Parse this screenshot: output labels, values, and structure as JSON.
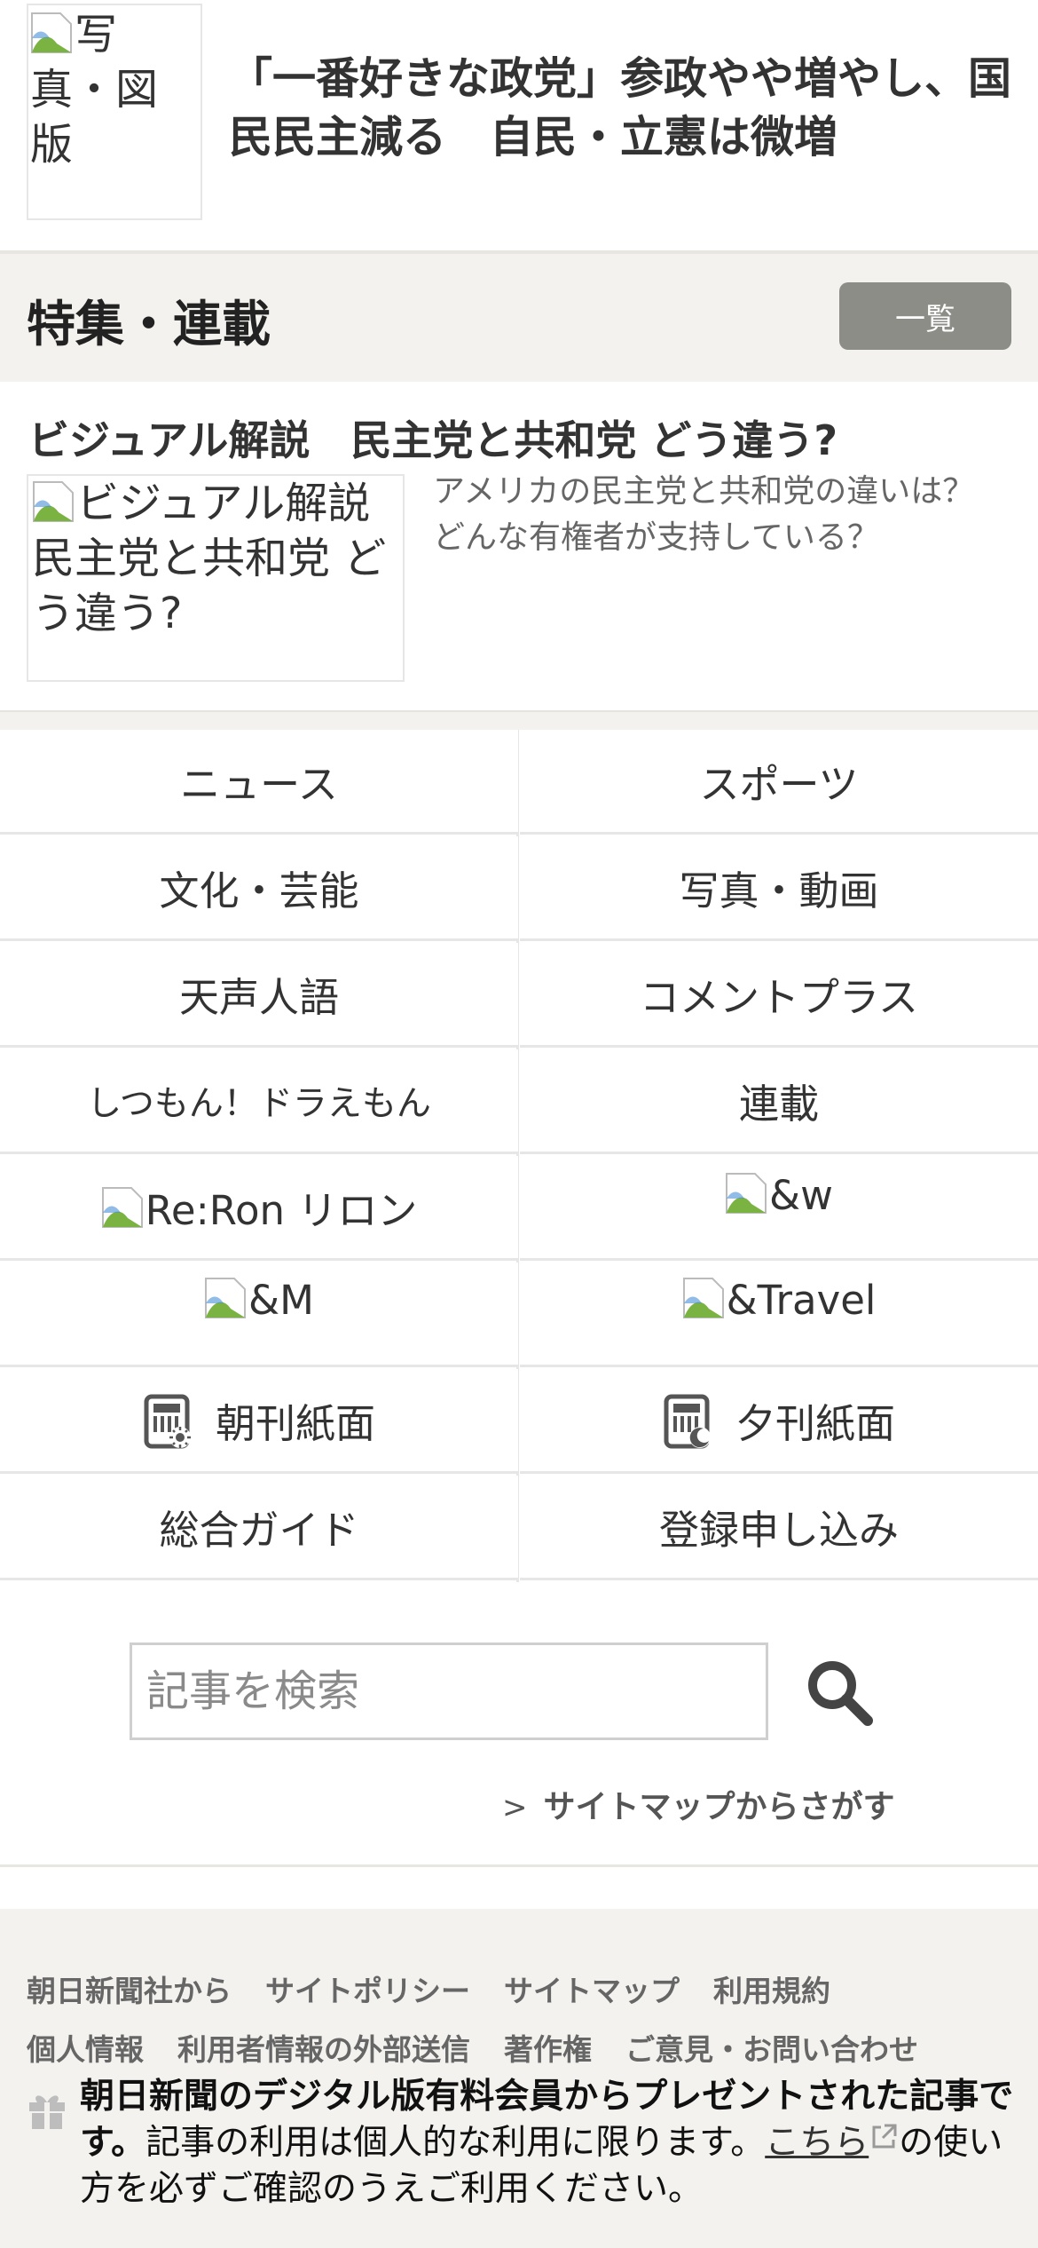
{
  "top_article": {
    "thumb_alt": "写真・図版",
    "title": "「一番好きな政党」参政やや増やし、国民民主減る　自民・立憲は微増"
  },
  "features": {
    "heading": "特集・連載",
    "list_button": "一覧",
    "article": {
      "title": "ビジュアル解説　民主党と共和党 どう違う?",
      "thumb_alt": "ビジュアル解説　民主党と共和党 どう違う?",
      "description": "アメリカの民主党と共和党の違いは？どんな有権者が支持している？"
    }
  },
  "nav": {
    "news": "ニュース",
    "sports": "スポーツ",
    "culture": "文化・芸能",
    "photo_video": "写真・動画",
    "tensei_jingo": "天声人語",
    "comment_plus": "コメントプラス",
    "shitsumon": "しつもん！ドラえもん",
    "rensai": "連載",
    "reron": "Re:Ron リロン",
    "and_w": "&w",
    "and_m": "&M",
    "and_travel": "&Travel",
    "morning_paper": "朝刊紙面",
    "evening_paper": "夕刊紙面",
    "guide": "総合ガイド",
    "register": "登録申し込み"
  },
  "search": {
    "placeholder": "記事を検索",
    "sitemap_link": "サイトマップからさがす"
  },
  "footer": {
    "links": [
      "朝日新聞社から",
      "サイトポリシー",
      "サイトマップ",
      "利用規約",
      "個人情報",
      "利用者情報の外部送信",
      "著作権",
      "ご意見・お問い合わせ"
    ],
    "gift_bold": "朝日新聞のデジタル版有料会員からプレゼントされた記事です。",
    "gift_text_1": "記事の利用は個人的な利用に限ります。",
    "gift_link": "こちら",
    "gift_text_2": "の使い方を必ずご確認のうえご利用ください。"
  },
  "colors": {
    "section_bg": "#f3f2ee",
    "button_gray": "#8d8d88",
    "divider": "#e6e6e6"
  }
}
